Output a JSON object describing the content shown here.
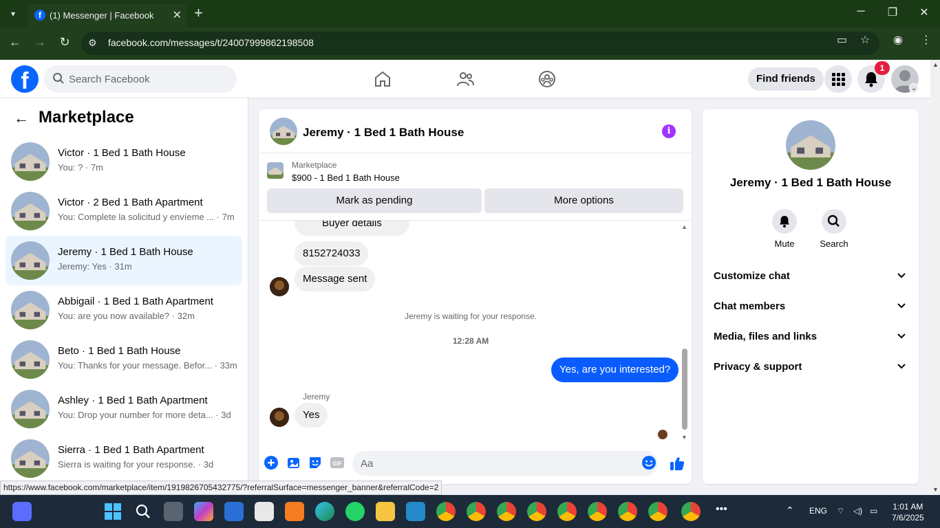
{
  "browser": {
    "tab_title": "(1) Messenger | Facebook",
    "url": "facebook.com/messages/t/24007999862198508",
    "status_url": "https://www.facebook.com/marketplace/item/1919826705432775/?referralSurface=messenger_banner&referralCode=2"
  },
  "fbnav": {
    "search_placeholder": "Search Facebook",
    "find_friends": "Find friends",
    "notification_count": "1"
  },
  "sidebar": {
    "title": "Marketplace",
    "conversations": [
      {
        "name": "Victor · 1 Bed 1 Bath House",
        "preview": "You: ? · 7m",
        "active": false
      },
      {
        "name": "Victor · 2 Bed 1 Bath Apartment",
        "preview": "You: Complete la solicitud y envíeme ... · 7m",
        "active": false
      },
      {
        "name": "Jeremy · 1 Bed 1 Bath House",
        "preview": "Jeremy: Yes · 31m",
        "active": true
      },
      {
        "name": "Abbigail · 1 Bed 1 Bath Apartment",
        "preview": "You: are you now available? · 32m",
        "active": false
      },
      {
        "name": "Beto · 1 Bed 1 Bath House",
        "preview": "You: Thanks for your message. Befor... · 33m",
        "active": false
      },
      {
        "name": "Ashley · 1 Bed 1 Bath Apartment",
        "preview": "You: Drop your number for more deta... · 3d",
        "active": false
      },
      {
        "name": "Sierra · 1 Bed 1 Bath Apartment",
        "preview": "Sierra is waiting for your response. · 3d",
        "active": false
      }
    ]
  },
  "chat": {
    "title": "Jeremy · 1 Bed 1 Bath House",
    "listing_source": "Marketplace",
    "listing_price": "$900 - 1 Bed 1 Bath House",
    "mark_pending": "Mark as pending",
    "more_options": "More options",
    "messages": {
      "buyer_details": "Buyer details",
      "phone": "8152724033",
      "message_sent": "Message sent",
      "waiting": "Jeremy is waiting for your response.",
      "time": "12:28 AM",
      "outgoing": "Yes, are you interested?",
      "sender_name": "Jeremy",
      "reply": "Yes"
    },
    "composer_placeholder": "Aa"
  },
  "info_panel": {
    "name": "Jeremy · 1 Bed 1 Bath House",
    "mute": "Mute",
    "search": "Search",
    "sections": [
      "Customize chat",
      "Chat members",
      "Media, files and links",
      "Privacy & support"
    ]
  },
  "taskbar": {
    "lang": "ENG",
    "time": "1:01 AM",
    "date": "7/6/2025"
  },
  "colors": {
    "fb_blue": "#0866ff",
    "messenger_blue": "#0a5cff",
    "info_purple": "#a033ff",
    "browser_frame": "#1a3a16"
  }
}
